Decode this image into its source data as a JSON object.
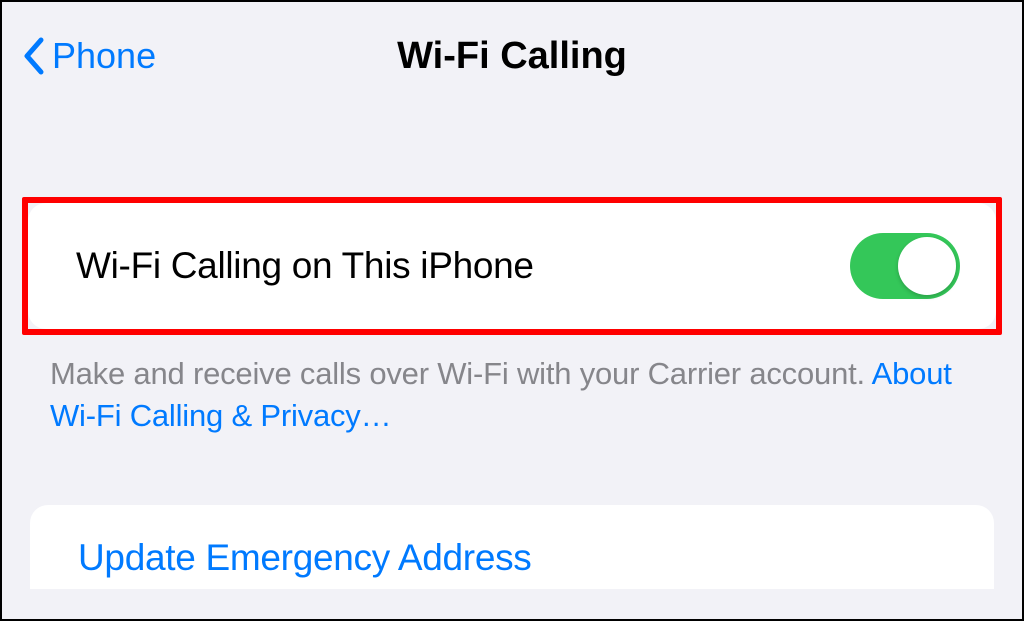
{
  "header": {
    "back_label": "Phone",
    "title": "Wi-Fi Calling"
  },
  "row1": {
    "label": "Wi-Fi Calling on This iPhone",
    "toggle_on": true
  },
  "footer": {
    "text": "Make and receive calls over Wi-Fi with your Carrier account. ",
    "link": "About Wi-Fi Calling & Privacy…"
  },
  "row2": {
    "label": "Update Emergency Address"
  }
}
